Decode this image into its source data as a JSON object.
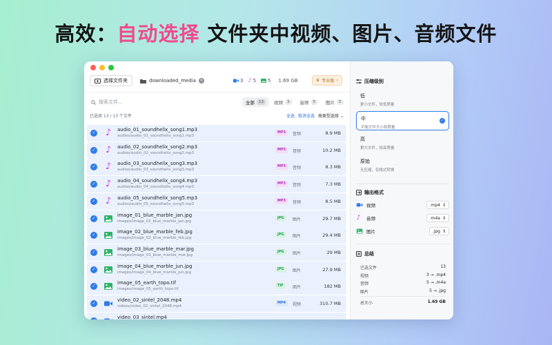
{
  "headline": {
    "prefix": "高效：",
    "highlight": "自动选择",
    "suffix": " 文件夹中视频、图片、音频文件"
  },
  "toolbar": {
    "choose_folder_label": "选择文件夹",
    "folder_name": "downloaded_media",
    "video_count": "3",
    "audio_count": "5",
    "image_count": "5",
    "total_size": "1.69 GB",
    "pro_label": "专业版"
  },
  "search": {
    "placeholder": "搜索文件..."
  },
  "tabs": [
    {
      "label": "全部",
      "count": "13"
    },
    {
      "label": "视频",
      "count": "3"
    },
    {
      "label": "音频",
      "count": "5"
    },
    {
      "label": "图片",
      "count": "5"
    }
  ],
  "status": {
    "selected_text": "已选择 13 / 13 个文件",
    "select_all": "全选",
    "deselect_all": "取消全选",
    "sort_label": "按类型选择"
  },
  "files": [
    {
      "name": "audio_01_soundhelix_song1.mp3",
      "path": "audios/audio_01_soundhelix_song1.mp3",
      "badge": "MP3",
      "type": "音频",
      "size": "8.9 MB",
      "kind": "audio"
    },
    {
      "name": "audio_02_soundhelix_song2.mp3",
      "path": "audios/audio_02_soundhelix_song2.mp3",
      "badge": "MP3",
      "type": "音频",
      "size": "10.2 MB",
      "kind": "audio"
    },
    {
      "name": "audio_03_soundhelix_song3.mp3",
      "path": "audios/audio_03_soundhelix_song3.mp3",
      "badge": "MP3",
      "type": "音频",
      "size": "8.3 MB",
      "kind": "audio"
    },
    {
      "name": "audio_04_soundhelix_song4.mp3",
      "path": "audios/audio_04_soundhelix_song4.mp3",
      "badge": "MP3",
      "type": "音频",
      "size": "7.3 MB",
      "kind": "audio"
    },
    {
      "name": "audio_05_soundhelix_song5.mp3",
      "path": "audios/audio_05_soundhelix_song5.mp3",
      "badge": "MP3",
      "type": "音频",
      "size": "8.5 MB",
      "kind": "audio"
    },
    {
      "name": "image_01_blue_marble_jan.jpg",
      "path": "images/image_01_blue_marble_jan.jpg",
      "badge": "JPG",
      "type": "图片",
      "size": "29.7 MB",
      "kind": "image"
    },
    {
      "name": "image_02_blue_marble_feb.jpg",
      "path": "images/image_02_blue_marble_feb.jpg",
      "badge": "JPG",
      "type": "图片",
      "size": "29.4 MB",
      "kind": "image"
    },
    {
      "name": "image_03_blue_marble_mar.jpg",
      "path": "images/image_03_blue_marble_mar.jpg",
      "badge": "JPG",
      "type": "图片",
      "size": "29 MB",
      "kind": "image"
    },
    {
      "name": "image_04_blue_marble_jun.jpg",
      "path": "images/image_04_blue_marble_jun.jpg",
      "badge": "JPG",
      "type": "图片",
      "size": "27.9 MB",
      "kind": "image"
    },
    {
      "name": "image_05_earth_topo.tif",
      "path": "images/image_05_earth_topo.tif",
      "badge": "TIF",
      "type": "图片",
      "size": "182 MB",
      "kind": "image"
    },
    {
      "name": "video_02_sintel_2048.mp4",
      "path": "videos/video_02_sintel_2048.mp4",
      "badge": "MP4",
      "type": "视频",
      "size": "310.7 MB",
      "kind": "video"
    },
    {
      "name": "video_03_sintel.mp4",
      "path": "",
      "badge": "",
      "type": "",
      "size": "",
      "kind": "video"
    }
  ],
  "compression": {
    "title": "压缩级别",
    "levels": [
      {
        "title": "低",
        "desc": "更小文件，较低质量"
      },
      {
        "title": "中",
        "desc": "平衡文件大小和质量",
        "selected": true
      },
      {
        "title": "高",
        "desc": "更大文件，较高质量"
      },
      {
        "title": "原始",
        "desc": "无压缩，仅格式转换"
      }
    ]
  },
  "output": {
    "title": "输出格式",
    "rows": [
      {
        "label": "视频",
        "value": ".mp4"
      },
      {
        "label": "音频",
        "value": ".m4a"
      },
      {
        "label": "图片",
        "value": ".jpg"
      }
    ]
  },
  "summary": {
    "title": "总结",
    "rows": [
      {
        "label": "已选文件",
        "value": "13"
      },
      {
        "label": "视频",
        "value": "3 → .mp4"
      },
      {
        "label": "音频",
        "value": "5 → .m4a"
      },
      {
        "label": "图片",
        "value": "5 → .jpg"
      }
    ],
    "total_label": "总大小",
    "total_value": "1.69 GB"
  },
  "colors": {
    "accent": "#2f7be8",
    "audio": "#c43fd4",
    "image": "#2fb26a",
    "video": "#2f7be8",
    "highlight": "#f04a8c"
  },
  "icons": {
    "audio": "music-note-icon",
    "image": "photo-icon",
    "video": "video-camera-icon"
  }
}
